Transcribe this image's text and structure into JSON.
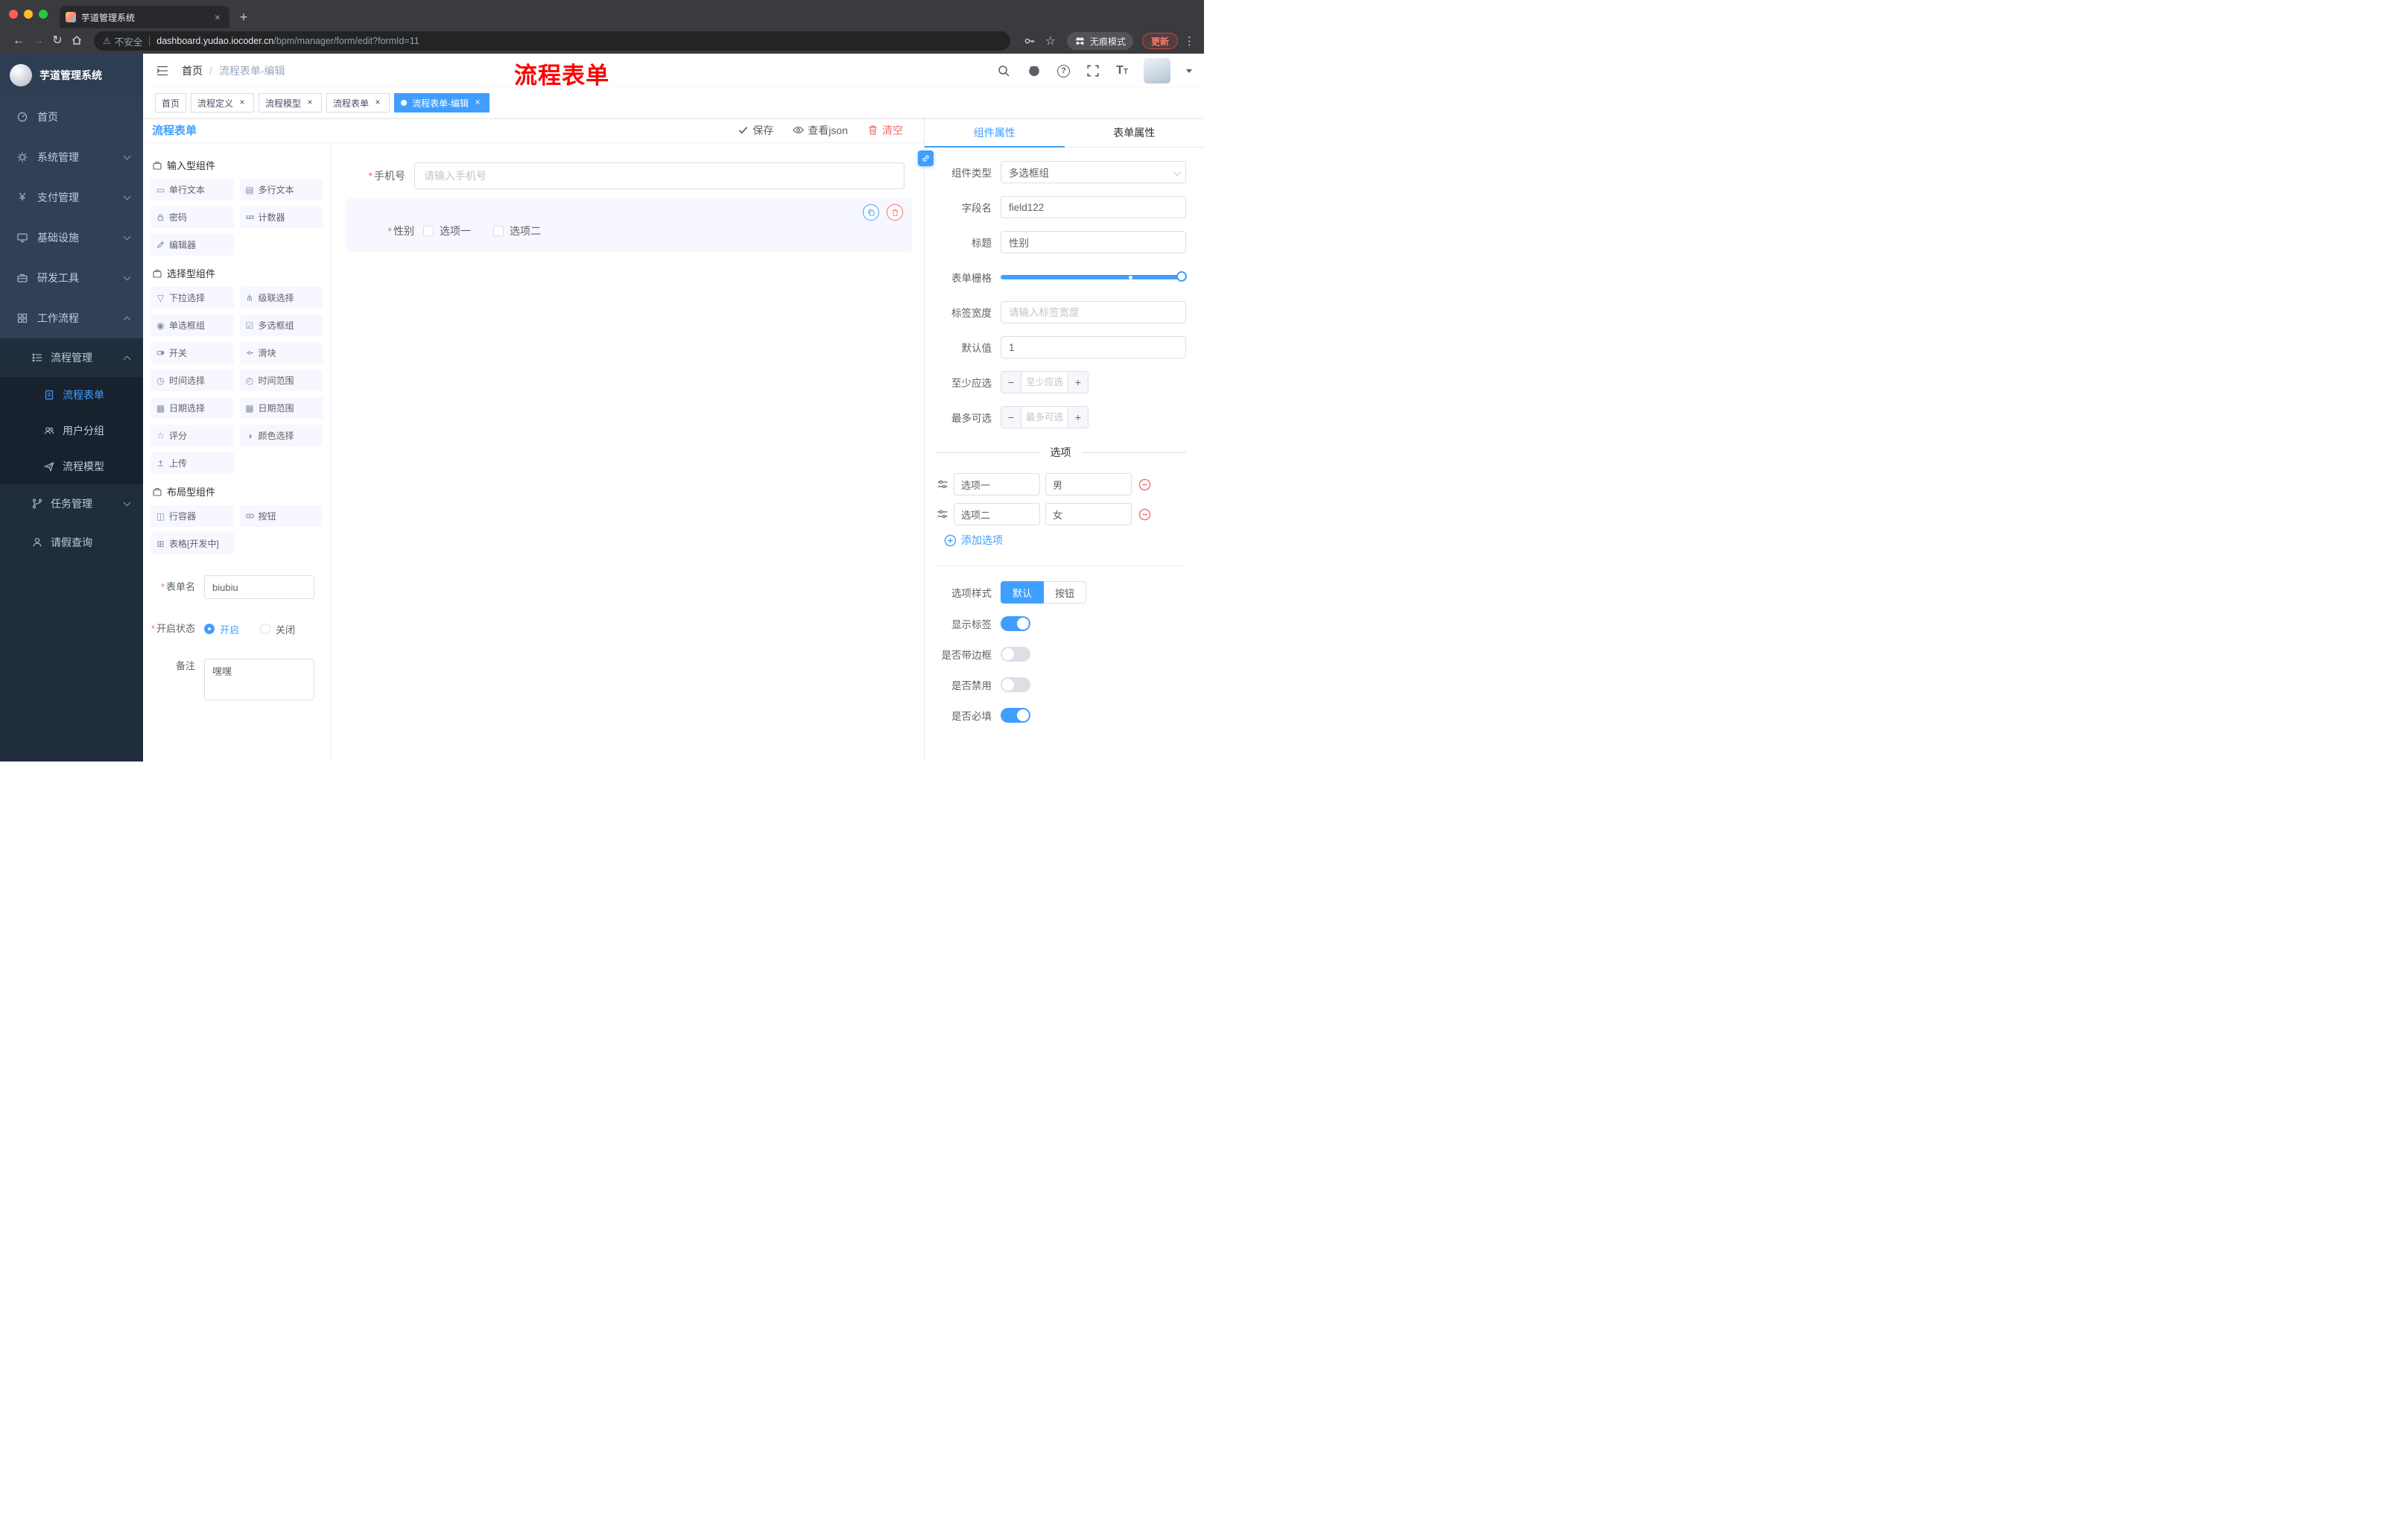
{
  "browser": {
    "tab_title": "芋道管理系统",
    "security_label": "不安全",
    "url_host": "dashboard.yudao.iocoder.cn",
    "url_path": "/bpm/manager/form/edit?formId=11",
    "incognito_label": "无痕模式",
    "update_label": "更新"
  },
  "sidebar": {
    "app_title": "芋道管理系统",
    "items": [
      {
        "label": "首页"
      },
      {
        "label": "系统管理"
      },
      {
        "label": "支付管理"
      },
      {
        "label": "基础设施"
      },
      {
        "label": "研发工具"
      },
      {
        "label": "工作流程"
      }
    ],
    "workflow": {
      "process_mgmt": {
        "label": "流程管理"
      },
      "process_children": [
        {
          "label": "流程表单"
        },
        {
          "label": "用户分组"
        },
        {
          "label": "流程模型"
        }
      ],
      "task_mgmt": {
        "label": "任务管理"
      },
      "leave_query": {
        "label": "请假查询"
      }
    }
  },
  "header": {
    "breadcrumb": {
      "home": "首页",
      "current": "流程表单-编辑"
    },
    "annotation": "流程表单"
  },
  "tags": [
    {
      "label": "首页"
    },
    {
      "label": "流程定义"
    },
    {
      "label": "流程模型"
    },
    {
      "label": "流程表单"
    },
    {
      "label": "流程表单-编辑"
    }
  ],
  "designer": {
    "title": "流程表单",
    "toolbar": {
      "save": "保存",
      "view_json": "查看json",
      "clear": "清空"
    },
    "palette": {
      "groups": [
        {
          "title": "输入型组件",
          "items": [
            {
              "label": "单行文本"
            },
            {
              "label": "多行文本"
            },
            {
              "label": "密码"
            },
            {
              "label": "计数器"
            },
            {
              "label": "编辑器"
            }
          ]
        },
        {
          "title": "选择型组件",
          "items": [
            {
              "label": "下拉选择"
            },
            {
              "label": "级联选择"
            },
            {
              "label": "单选框组"
            },
            {
              "label": "多选框组"
            },
            {
              "label": "开关"
            },
            {
              "label": "滑块"
            },
            {
              "label": "时间选择"
            },
            {
              "label": "时间范围"
            },
            {
              "label": "日期选择"
            },
            {
              "label": "日期范围"
            },
            {
              "label": "评分"
            },
            {
              "label": "颜色选择"
            },
            {
              "label": "上传"
            }
          ]
        },
        {
          "title": "布局型组件",
          "items": [
            {
              "label": "行容器"
            },
            {
              "label": "按钮"
            },
            {
              "label": "表格[开发中]"
            }
          ]
        }
      ]
    },
    "meta": {
      "form_name": {
        "label": "表单名",
        "value": "biubiu"
      },
      "status": {
        "label": "开启状态",
        "options": [
          "开启",
          "关闭"
        ],
        "selected": "开启"
      },
      "remark": {
        "label": "备注",
        "value": "嘿嘿"
      }
    },
    "canvas": {
      "phone": {
        "label": "手机号",
        "placeholder": "请输入手机号"
      },
      "gender": {
        "label": "性别",
        "options": [
          "选项一",
          "选项二"
        ]
      }
    }
  },
  "inspector": {
    "tabs": {
      "component": "组件属性",
      "form": "表单属性"
    },
    "fields": {
      "component_type": {
        "label": "组件类型",
        "value": "多选框组"
      },
      "field_name": {
        "label": "字段名",
        "value": "field122"
      },
      "title": {
        "label": "标题",
        "value": "性别"
      },
      "grid": {
        "label": "表单栅格"
      },
      "label_width": {
        "label": "标签宽度",
        "placeholder": "请输入标签宽度"
      },
      "default_value": {
        "label": "默认值",
        "value": "1"
      },
      "min_select": {
        "label": "至少应选",
        "placeholder": "至少应选"
      },
      "max_select": {
        "label": "最多可选",
        "placeholder": "最多可选"
      }
    },
    "options_divider": "选项",
    "options": [
      {
        "label": "选项一",
        "value": "男"
      },
      {
        "label": "选项二",
        "value": "女"
      }
    ],
    "add_option": "添加选项",
    "option_style": {
      "label": "选项样式",
      "choices": [
        "默认",
        "按钮"
      ],
      "selected": "默认"
    },
    "switches": [
      {
        "label": "显示标签",
        "on": true
      },
      {
        "label": "是否带边框",
        "on": false
      },
      {
        "label": "是否禁用",
        "on": false
      },
      {
        "label": "是否必填",
        "on": true
      }
    ]
  },
  "colors": {
    "accent": "#409eff",
    "danger": "#f56c6c",
    "annotation": "#fe0000"
  }
}
